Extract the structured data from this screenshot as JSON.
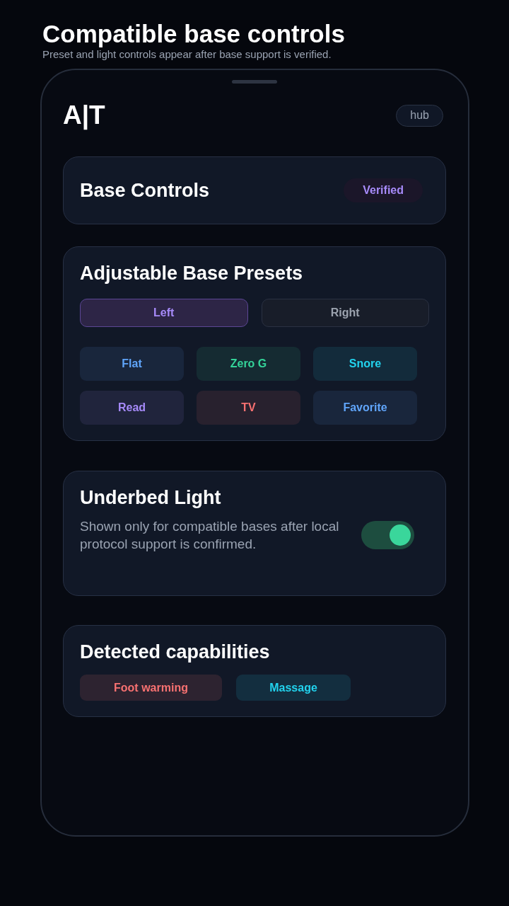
{
  "page": {
    "title": "Compatible base controls",
    "subtitle": "Preset and light controls appear after base support is verified."
  },
  "app": {
    "logo": "A|T",
    "hub_label": "hub"
  },
  "base_controls": {
    "title": "Base Controls",
    "status": "Verified"
  },
  "presets_card": {
    "title": "Adjustable Base Presets",
    "sides": [
      {
        "label": "Left",
        "selected": true
      },
      {
        "label": "Right",
        "selected": false
      }
    ],
    "presets": [
      {
        "label": "Flat",
        "color": "#60a5fa"
      },
      {
        "label": "Zero G",
        "color": "#34d399"
      },
      {
        "label": "Snore",
        "color": "#22d3ee"
      },
      {
        "label": "Read",
        "color": "#a78bfa"
      },
      {
        "label": "TV",
        "color": "#f87171"
      },
      {
        "label": "Favorite",
        "color": "#60a5fa"
      }
    ]
  },
  "light_card": {
    "title": "Underbed Light",
    "description": "Shown only for compatible bases after local protocol support is confirmed.",
    "on": true
  },
  "capabilities_card": {
    "title": "Detected capabilities",
    "items": [
      {
        "label": "Foot warming",
        "color": "#f87171"
      },
      {
        "label": "Massage",
        "color": "#22d3ee"
      }
    ]
  }
}
